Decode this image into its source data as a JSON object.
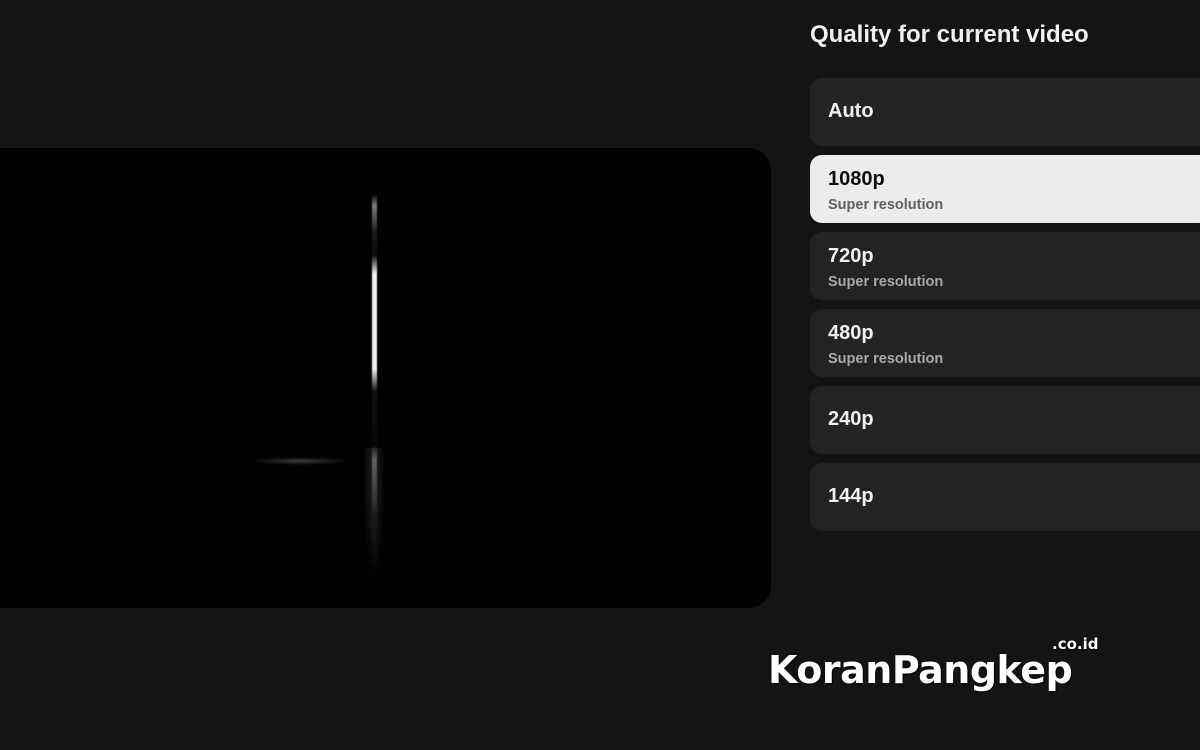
{
  "panel": {
    "title": "Quality for current video",
    "options": [
      {
        "label": "Auto",
        "sublabel": ""
      },
      {
        "label": "1080p",
        "sublabel": "Super resolution",
        "selected": true
      },
      {
        "label": "720p",
        "sublabel": "Super resolution"
      },
      {
        "label": "480p",
        "sublabel": "Super resolution"
      },
      {
        "label": "240p",
        "sublabel": ""
      },
      {
        "label": "144p",
        "sublabel": ""
      }
    ]
  },
  "watermark": {
    "main": "KoranPangkep",
    "suffix": ".co.id"
  },
  "colors": {
    "background": "#141414",
    "option_background": "#232323",
    "selected_background": "#ececec",
    "text_primary": "#f1f1f1",
    "text_secondary": "#a9a9a9"
  }
}
